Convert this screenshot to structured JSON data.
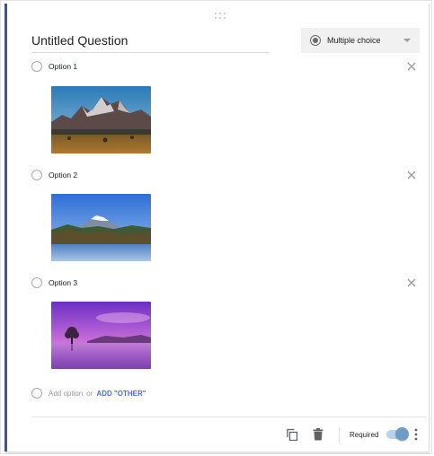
{
  "question": {
    "title": "Untitled Question",
    "type_label": "Multiple choice"
  },
  "options": [
    {
      "label": "Option 1",
      "image": "mountain-range-landscape"
    },
    {
      "label": "Option 2",
      "image": "snowy-mountain-lake"
    },
    {
      "label": "Option 3",
      "image": "purple-sunset-lake"
    }
  ],
  "add_row": {
    "add_option": "Add option",
    "or": "or",
    "add_other": "ADD \"OTHER\""
  },
  "footer": {
    "required_label": "Required",
    "required_on": true
  },
  "colors": {
    "accent_bar": "#3a4fb0",
    "link": "#4a6fd0",
    "toggle_track": "#b9d2ee",
    "toggle_knob": "#6f9cc7"
  },
  "icons": {
    "drag": "drag-handle-icon",
    "type": "radio-button-icon",
    "dropdown": "chevron-down-icon",
    "remove": "close-icon",
    "duplicate": "copy-icon",
    "delete": "trash-icon",
    "more": "more-vertical-icon"
  }
}
